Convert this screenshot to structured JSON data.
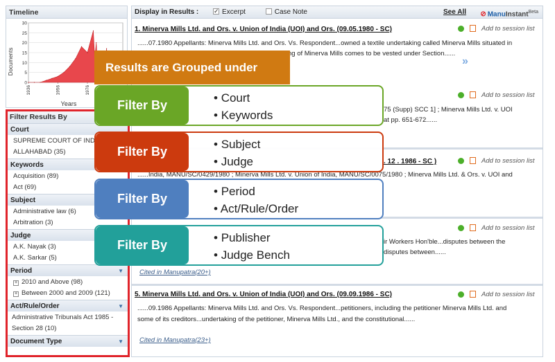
{
  "timeline": {
    "title": "Timeline",
    "ylabel": "Documents",
    "xlabel": "Years",
    "y_ticks": [
      "30",
      "25",
      "20",
      "15",
      "10",
      "5",
      "0"
    ],
    "x_ticks": [
      "1936",
      "1956",
      "1976",
      "1996"
    ]
  },
  "chart_data": {
    "type": "area",
    "title": "",
    "xlabel": "Years",
    "ylabel": "Documents",
    "ylim": [
      0,
      30
    ],
    "x": [
      1936,
      1940,
      1944,
      1948,
      1952,
      1956,
      1960,
      1964,
      1968,
      1972,
      1976,
      1980,
      1981,
      1982,
      1983,
      1984,
      1985,
      1986,
      1987,
      1988,
      1989,
      1990,
      1992,
      1994,
      1996
    ],
    "y": [
      0,
      0,
      0,
      1,
      2,
      3,
      5,
      8,
      12,
      18,
      15,
      26,
      12,
      20,
      6,
      14,
      9,
      11,
      4,
      7,
      17,
      8,
      6,
      4,
      3
    ],
    "grid": true
  },
  "filters": {
    "header": "Filter Results By",
    "sections": [
      {
        "title": "Court",
        "items": [
          "SUPREME COURT OF INDIA",
          "ALLAHABAD (35)"
        ]
      },
      {
        "title": "Keywords",
        "items": [
          "Acquisition (89)",
          "Act (69)"
        ]
      },
      {
        "title": "Subject",
        "items": [
          "Administrative law (6)",
          "Arbitration (3)"
        ]
      },
      {
        "title": "Judge",
        "items": [
          "A.K. Nayak (3)",
          "A.K. Sarkar (5)"
        ]
      },
      {
        "title": "Period",
        "items": [
          "2010 and Above (98)",
          "Between 2000 and 2009 (121)"
        ]
      },
      {
        "title": "Act/Rule/Order",
        "items": [
          "Administrative Tribunals Act 1985 -",
          "Section 28 (10)"
        ]
      },
      {
        "title": "Document Type",
        "items": []
      }
    ]
  },
  "results_bar": {
    "display_label": "Display in Results :",
    "excerpt": "Excerpt",
    "case_note": "Case Note",
    "see_all": "See All",
    "brand_manu": "Manu",
    "brand_instant": "Instant",
    "beta": "Beta"
  },
  "results": [
    {
      "title": "1. Minerva Mills Ltd. and Ors. v. Union of India (UOI) and Ors. (09.05.1980 - SC)",
      "snippet_1": "......07.1980 Appellants: Minerva Mills Ltd. and Ors. Vs. Respondent...owned a textile undertaking called Minerva Mills situated in",
      "snippet_2": "ng of Minerva Mills comes to be vested under Section......",
      "session": "Add to session list"
    },
    {
      "snippet_1": "75 (Supp) SCC 1] ; Minerva Mills Ltd. v. UOI",
      "snippet_2": "at pp. 651-672......",
      "session": "Add to session list"
    },
    {
      "title_tail": ". 12 . 1986 - SC )",
      "snippet_1": "......India, MANU/SC/0429/1980 ; Minerva Mills Ltd. v. Union of India, MANU/SC/0075/1980 ; Minerva Mills Ltd. & Ors. v. UOI and",
      "session": "Add to session list"
    },
    {
      "snippet_1": "ir Workers Hon'ble...disputes between the",
      "snippet_2": "disputes between......",
      "session": "Add to session list",
      "cited": "Cited in Manupatra(20+)"
    },
    {
      "title": "5. Minerva Mills Ltd. and Ors. v. Union of India (UOI) and Ors. (09.09.1986 - SC)",
      "snippet_1": "......09.1986 Appellants: Minerva Mills Ltd. and Ors. Vs. Respondent...petitioners, including the petitioner Minerva Mills Ltd. and",
      "snippet_2": "some of its creditors...undertaking of the petitioner, Minerva Mills Ltd., and the constitutional......",
      "session": "Add to session list",
      "cited": "Cited in Manupatra(23+)"
    }
  ],
  "overlay": {
    "banner": "Results are Grouped under",
    "cards": [
      {
        "label": "Filter By",
        "lines": [
          "Court",
          "Keywords"
        ],
        "color": "#6aa626"
      },
      {
        "label": "Filter By",
        "lines": [
          "Subject",
          "Judge"
        ],
        "color": "#cc3a0e"
      },
      {
        "label": "Filter By",
        "lines": [
          "Period",
          "Act/Rule/Order"
        ],
        "color": "#4f7fbf"
      },
      {
        "label": "Filter By",
        "lines": [
          "Publisher",
          "Judge Bench"
        ],
        "color": "#22a09a"
      }
    ]
  },
  "colors": {
    "filter_border": "#e0242b",
    "banner": "#d07a12",
    "chart_fill": "#e8474c"
  }
}
